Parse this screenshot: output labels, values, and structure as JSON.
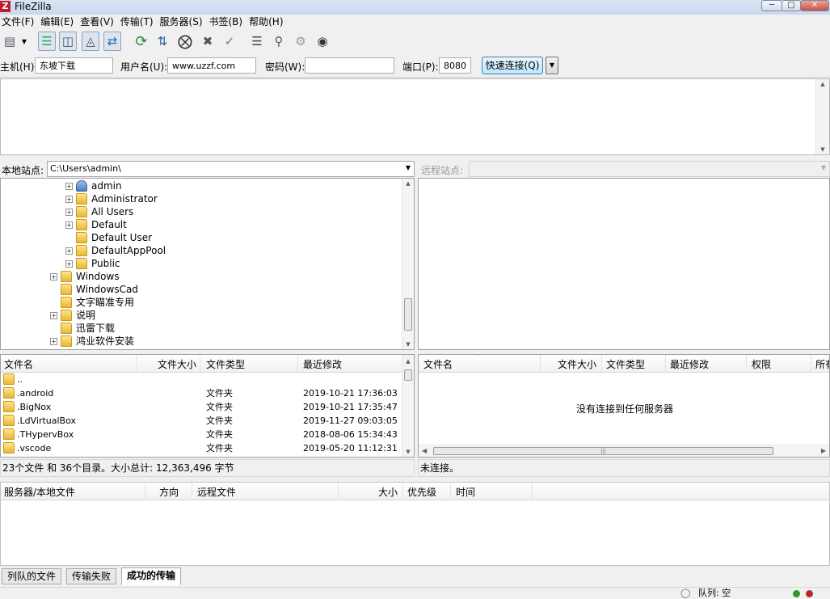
{
  "window": {
    "title": "FileZilla",
    "logo": "Z"
  },
  "menu": [
    "文件(F)",
    "编辑(E)",
    "查看(V)",
    "传输(T)",
    "服务器(S)",
    "书签(B)",
    "帮助(H)"
  ],
  "quickconnect": {
    "host_label": "主机(H):",
    "host_value": "东坡下载",
    "user_label": "用户名(U):",
    "user_value": "www.uzzf.com",
    "pass_label": "密码(W):",
    "pass_value": "",
    "port_label": "端口(P):",
    "port_value": "8080",
    "connect_label": "快速连接(Q)"
  },
  "local": {
    "site_label": "本地站点:",
    "path": "C:\\Users\\admin\\",
    "tree": [
      {
        "name": "admin",
        "level": 2,
        "user": true
      },
      {
        "name": "Administrator",
        "level": 2
      },
      {
        "name": "All Users",
        "level": 2
      },
      {
        "name": "Default",
        "level": 2
      },
      {
        "name": "Default User",
        "level": 2,
        "noexp": true
      },
      {
        "name": "DefaultAppPool",
        "level": 2
      },
      {
        "name": "Public",
        "level": 2
      },
      {
        "name": "Windows",
        "level": 1
      },
      {
        "name": "WindowsCad",
        "level": 1,
        "noexp": true
      },
      {
        "name": "文字瞄准专用",
        "level": 1,
        "noexp": true
      },
      {
        "name": "说明",
        "level": 1
      },
      {
        "name": "迅雷下载",
        "level": 1,
        "noexp": true
      },
      {
        "name": "鸿业软件安装",
        "level": 1
      }
    ],
    "columns": {
      "name": "文件名",
      "size": "文件大小",
      "type": "文件类型",
      "modified": "最近修改"
    },
    "files": [
      {
        "name": "..",
        "type": "",
        "modified": ""
      },
      {
        "name": ".android",
        "type": "文件夹",
        "modified": "2019-10-21 17:36:03"
      },
      {
        "name": ".BigNox",
        "type": "文件夹",
        "modified": "2019-10-21 17:35:47"
      },
      {
        "name": ".LdVirtualBox",
        "type": "文件夹",
        "modified": "2019-11-27 09:03:05"
      },
      {
        "name": ".THypervBox",
        "type": "文件夹",
        "modified": "2018-08-06 15:34:43"
      },
      {
        "name": ".vscode",
        "type": "文件夹",
        "modified": "2019-05-20 11:12:31"
      }
    ],
    "status": "23个文件 和 36个目录。大小总计: 12,363,496 字节"
  },
  "remote": {
    "site_label": "远程站点:",
    "columns": {
      "name": "文件名",
      "size": "文件大小",
      "type": "文件类型",
      "modified": "最近修改",
      "perms": "权限",
      "owner": "所有"
    },
    "empty_msg": "没有连接到任何服务器",
    "status": "未连接。"
  },
  "queue": {
    "columns": {
      "server": "服务器/本地文件",
      "direction": "方向",
      "remote": "远程文件",
      "size": "大小",
      "priority": "优先级",
      "time": "时间"
    }
  },
  "tabs": [
    "列队的文件",
    "传输失败",
    "成功的传输"
  ],
  "statusbar": {
    "queue": "队列: 空"
  }
}
